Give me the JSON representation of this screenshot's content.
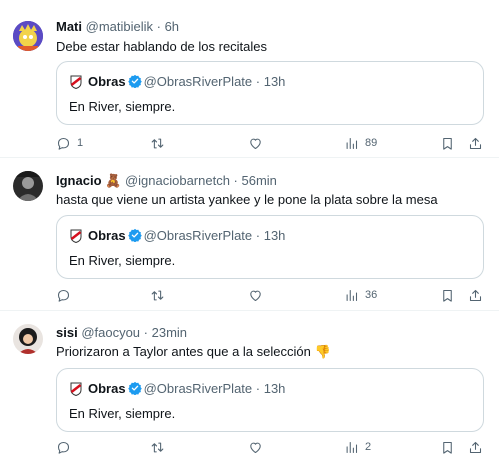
{
  "tweets": [
    {
      "name": "Mati",
      "handle": "@matibielik",
      "time": "6h",
      "text": "Debe estar hablando de los recitales",
      "quote": {
        "name": "Obras",
        "handle": "@ObrasRiverPlate",
        "time": "13h",
        "text": "En River, siempre."
      },
      "replies": "1",
      "retweets": "",
      "likes": "",
      "views": "89"
    },
    {
      "name": "Ignacio",
      "emoji": "🧸",
      "handle": "@ignaciobarnetch",
      "time": "56min",
      "text": "hasta que viene un artista yankee y le pone la plata sobre la mesa",
      "quote": {
        "name": "Obras",
        "handle": "@ObrasRiverPlate",
        "time": "13h",
        "text": "En River, siempre."
      },
      "replies": "",
      "retweets": "",
      "likes": "",
      "views": "36"
    },
    {
      "name": "sisi",
      "handle": "@faocyou",
      "time": "23min",
      "text": "Priorizaron a Taylor antes que a la selección 👎",
      "quote": {
        "name": "Obras",
        "handle": "@ObrasRiverPlate",
        "time": "13h",
        "text": "En River, siempre."
      },
      "replies": "",
      "retweets": "",
      "likes": "",
      "views": "2"
    }
  ],
  "separator": " · ",
  "colors": {
    "text": "#0f1419",
    "secondary": "#536471",
    "border": "#cfd9de",
    "verified": "#1d9bf0"
  }
}
